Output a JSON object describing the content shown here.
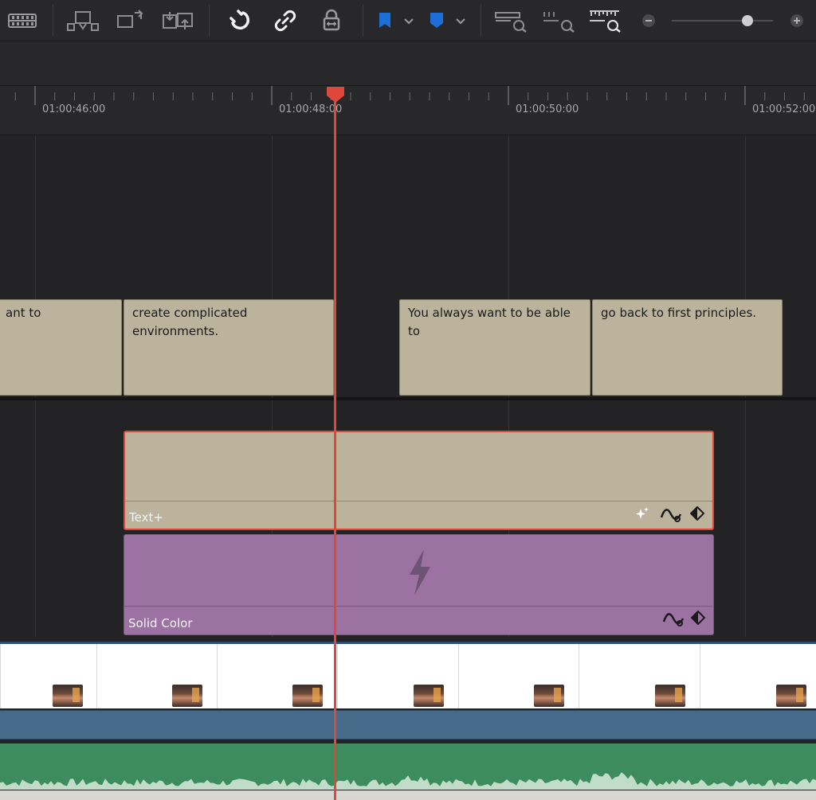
{
  "toolbar": {
    "icons": [
      "film-strip-icon",
      "overwrite-clip-icon",
      "replace-clip-icon",
      "ripple-overwrite-icon",
      "snapping-icon",
      "link-icon",
      "position-lock-icon",
      "flag-icon",
      "chevron-down-icon",
      "marker-icon",
      "chevron-down-icon",
      "zoom-full-icon",
      "zoom-detail-icon",
      "zoom-custom-icon",
      "zoom-out-icon",
      "zoom-in-icon"
    ],
    "zoom_level": 0.75,
    "colors": {
      "flag": "#1b6fd6",
      "marker": "#1b6fd6"
    }
  },
  "ruler": {
    "timecodes": [
      "01:00:46:00",
      "01:00:48:00",
      "01:00:50:00",
      "01:00:52:00"
    ]
  },
  "subtitles": [
    {
      "text": "ant to"
    },
    {
      "text": "create complicated environments."
    },
    {
      "text": "You always want to be able to"
    },
    {
      "text": "go back to first principles."
    }
  ],
  "clips": {
    "text_plus": {
      "label": "Text+",
      "selected": true
    },
    "solid_color": {
      "label": "Solid Color"
    }
  },
  "colors": {
    "playhead": "#e0473b",
    "subtitle_clip": "#bbb39c",
    "solid_color_clip": "#9b72a2",
    "audio_track": "#3d8c5d",
    "video_track": "#456a8a"
  }
}
